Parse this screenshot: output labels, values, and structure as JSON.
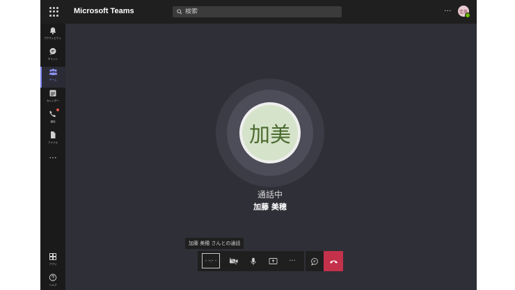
{
  "app": {
    "title": "Microsoft Teams"
  },
  "search": {
    "placeholder": "検索"
  },
  "user": {
    "initials": "佳美",
    "presence": "available"
  },
  "rail": {
    "items": [
      {
        "label": "アクティビティ",
        "icon": "bell-icon"
      },
      {
        "label": "チャット",
        "icon": "chat-icon"
      },
      {
        "label": "チーム",
        "icon": "teams-icon",
        "active": true
      },
      {
        "label": "カレンダー",
        "icon": "calendar-icon"
      },
      {
        "label": "通話",
        "icon": "phone-icon",
        "badge": true
      },
      {
        "label": "ファイル",
        "icon": "file-icon"
      }
    ],
    "more": "···",
    "bottom": [
      {
        "label": "アプリ",
        "icon": "apps-icon"
      },
      {
        "label": "ヘルプ",
        "icon": "help-icon"
      }
    ]
  },
  "call": {
    "avatar_initials": "加美",
    "status": "通話中",
    "caller_name": "加藤 美穂",
    "tooltip": "加藤 美穂 さんとの通話",
    "controls": {
      "selected_label": "- -:- -",
      "more": "···"
    }
  },
  "colors": {
    "accent": "#7b83eb",
    "hangup": "#c4314b",
    "avatar_bg": "#d6e3cb",
    "avatar_text": "#4a6b2e",
    "background": "#2f2f37"
  }
}
